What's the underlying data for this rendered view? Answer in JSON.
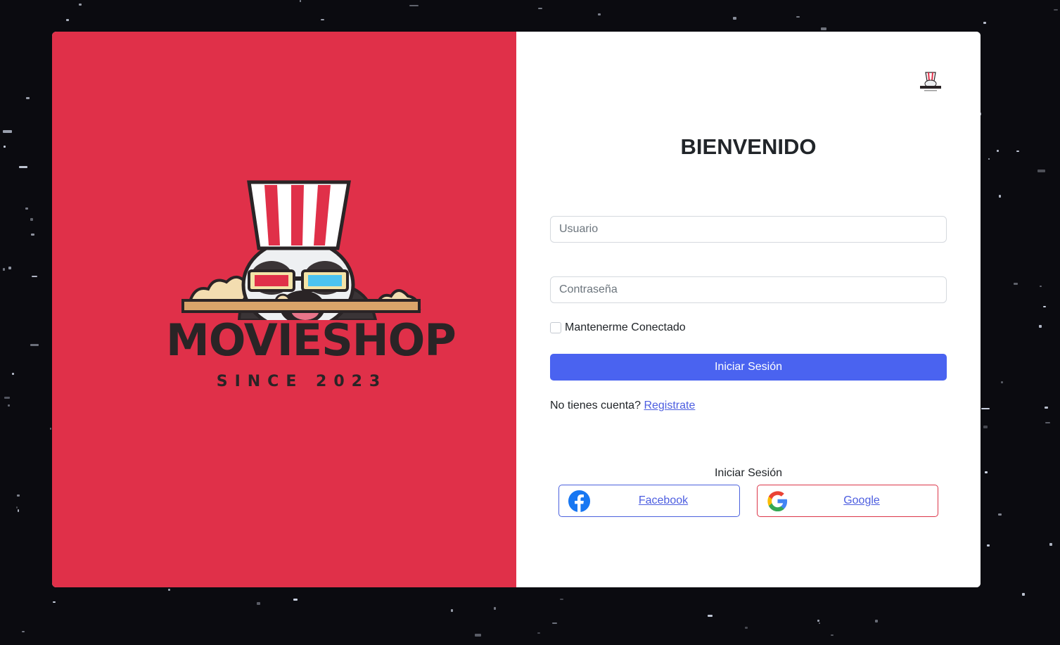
{
  "brand": {
    "name": "MOVIESHOP",
    "tagline": "SINCE 2023",
    "panel_color": "#e03049"
  },
  "login": {
    "title": "BIENVENIDO",
    "username_placeholder": "Usuario",
    "password_placeholder": "Contraseña",
    "remember_label": "Mantenerme Conectado",
    "submit_label": "Iniciar Sesión",
    "no_account_text": "No tienes cuenta?",
    "register_link": "Registrate"
  },
  "social": {
    "title": "Iniciar Sesión",
    "facebook_label": "Facebook",
    "facebook_icon": "facebook-icon",
    "google_label": "Google",
    "google_icon": "google-icon"
  },
  "colors": {
    "primary_button": "#4a63f0",
    "link": "#4d5ee0",
    "facebook": "#1877f2",
    "google_border": "#dc3549"
  }
}
